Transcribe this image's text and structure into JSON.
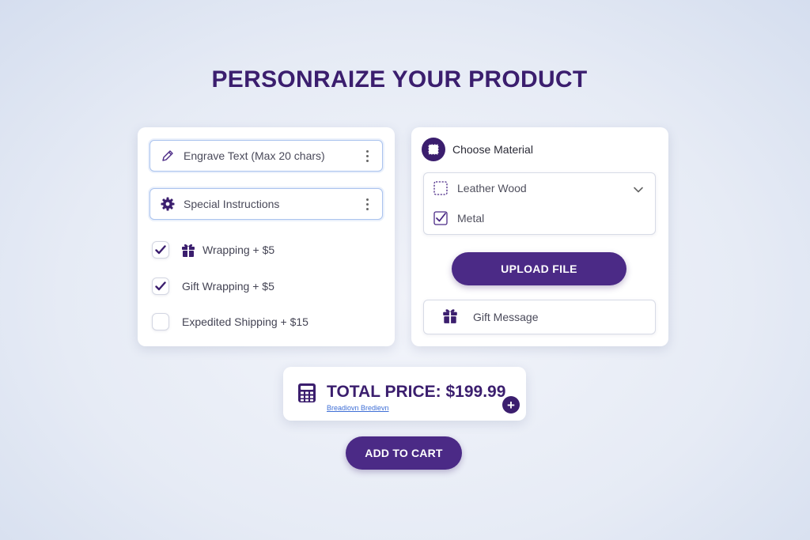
{
  "page": {
    "title": "PERSONRAIZE YOUR PRODUCT"
  },
  "left_panel": {
    "engrave_field": {
      "label": "Engrave Text (Max 20 chars)",
      "icon": "pencil-icon"
    },
    "instructions_field": {
      "label": "Special Instructions",
      "icon": "gear-icon"
    },
    "options": [
      {
        "label": "Wrapping + $5",
        "checked": true,
        "icon": "gift-icon"
      },
      {
        "label": "Gift Wrapping + $5",
        "checked": true
      },
      {
        "label": "Expedited Shipping + $15",
        "checked": false
      }
    ]
  },
  "right_panel": {
    "material": {
      "title": "Choose Material",
      "options": [
        {
          "label": "Leather Wood",
          "checked": false
        },
        {
          "label": "Metal",
          "checked": true
        }
      ]
    },
    "upload_button": "UPLOAD FILE",
    "gift_message": {
      "label": "Gift Message",
      "icon": "gift-icon"
    }
  },
  "total": {
    "label": "TOTAL PRICE: $199.99",
    "breakdown_link": "Breadiovn Bredievn",
    "icon": "calculator-icon"
  },
  "add_to_cart": "ADD TO CART",
  "colors": {
    "brand": "#3b1e6e",
    "button": "#4b2a86",
    "link": "#3f6fd6",
    "field_border": "#aac3ee"
  }
}
